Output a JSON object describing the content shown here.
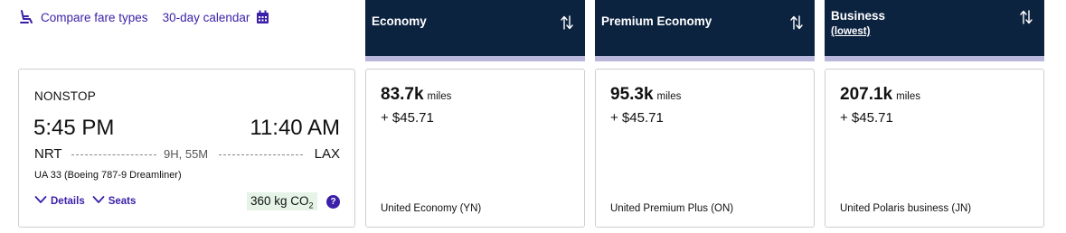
{
  "toolbar": {
    "compare_label": "Compare fare types",
    "calendar_label": "30-day calendar"
  },
  "columns": [
    {
      "title": "Economy",
      "subtitle": ""
    },
    {
      "title": "Premium Economy",
      "subtitle": ""
    },
    {
      "title": "Business",
      "subtitle": "(lowest)"
    }
  ],
  "flight": {
    "stops": "NONSTOP",
    "depart_time": "5:45 PM",
    "arrive_time": "11:40 AM",
    "origin": "NRT",
    "destination": "LAX",
    "duration": "9H, 55M",
    "flight_info": "UA 33 (Boeing 787-9 Dreamliner)",
    "details_label": "Details",
    "seats_label": "Seats",
    "co2_value": "360 kg CO",
    "co2_sub": "2",
    "info_icon": "?"
  },
  "fares": [
    {
      "miles": "83.7k",
      "miles_unit": "miles",
      "tax": "+ $45.71",
      "fare_name": "United Economy (YN)"
    },
    {
      "miles": "95.3k",
      "miles_unit": "miles",
      "tax": "+ $45.71",
      "fare_name": "United Premium Plus (ON)"
    },
    {
      "miles": "207.1k",
      "miles_unit": "miles",
      "tax": "+ $45.71",
      "fare_name": "United Polaris business (JN)"
    }
  ],
  "colors": {
    "header_bg": "#0c2340",
    "header_stripe": "#b9b8dc",
    "link": "#3b1fa8",
    "co2_bg": "#e6f4e8"
  }
}
